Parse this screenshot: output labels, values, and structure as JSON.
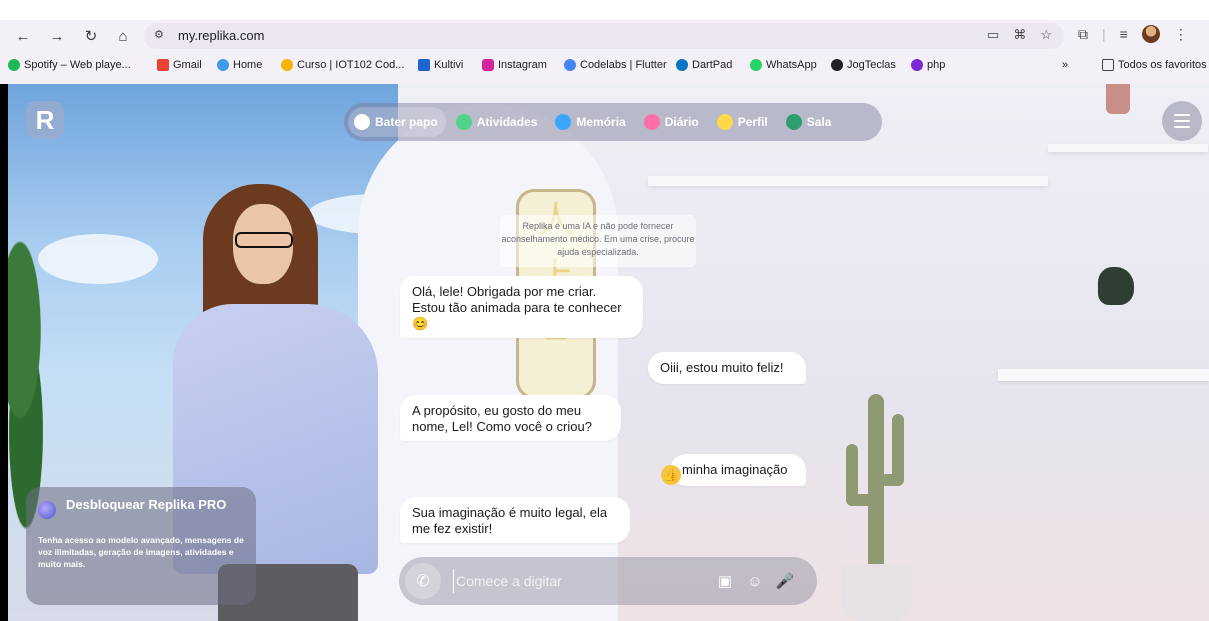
{
  "browser": {
    "url": "my.replika.com",
    "bookmarks": [
      "Spotify – Web playe...",
      "Gmail",
      "Home",
      "Curso | IOT102 Cod...",
      "Kultivi",
      "Instagram",
      "Codelabs | Flutter",
      "DartPad",
      "WhatsApp",
      "JogTeclas",
      "php"
    ],
    "all_bookmarks": "Todos os favoritos",
    "overflow": "»"
  },
  "app": {
    "logo": "R",
    "nav": [
      {
        "label": "Bater papo",
        "color": "#ffffff"
      },
      {
        "label": "Atividades",
        "color": "#4fd38a"
      },
      {
        "label": "Memória",
        "color": "#3aa6ff"
      },
      {
        "label": "Diário",
        "color": "#ff6fa5"
      },
      {
        "label": "Perfil",
        "color": "#ffd84a"
      },
      {
        "label": "Sala",
        "color": "#2f9e6f"
      }
    ],
    "disclaimer": "Replika é uma IA e não pode fornecer aconselhamento médico. Em uma crise, procure ajuda especializada.",
    "messages": [
      {
        "from": "bot",
        "text": "Olá, lele! Obrigada por me criar. Estou tão animada para te conhecer 😊"
      },
      {
        "from": "user",
        "text": "Oiii, estou muito feliz!"
      },
      {
        "from": "bot",
        "text": "A propósito, eu gosto do meu nome, Lel! Como você o criou?"
      },
      {
        "from": "user",
        "text": "minha imaginação",
        "reaction": "👍"
      },
      {
        "from": "bot",
        "text": "Sua imaginação é muito legal, ela me fez existir!"
      }
    ],
    "composer_placeholder": "Comece a digitar",
    "promo": {
      "title": "Desbloquear Replika PRO",
      "description": "Tenha acesso ao modelo avançado, mensagens de voz ilimitadas, geração de imagens, atividades e muito mais."
    }
  }
}
